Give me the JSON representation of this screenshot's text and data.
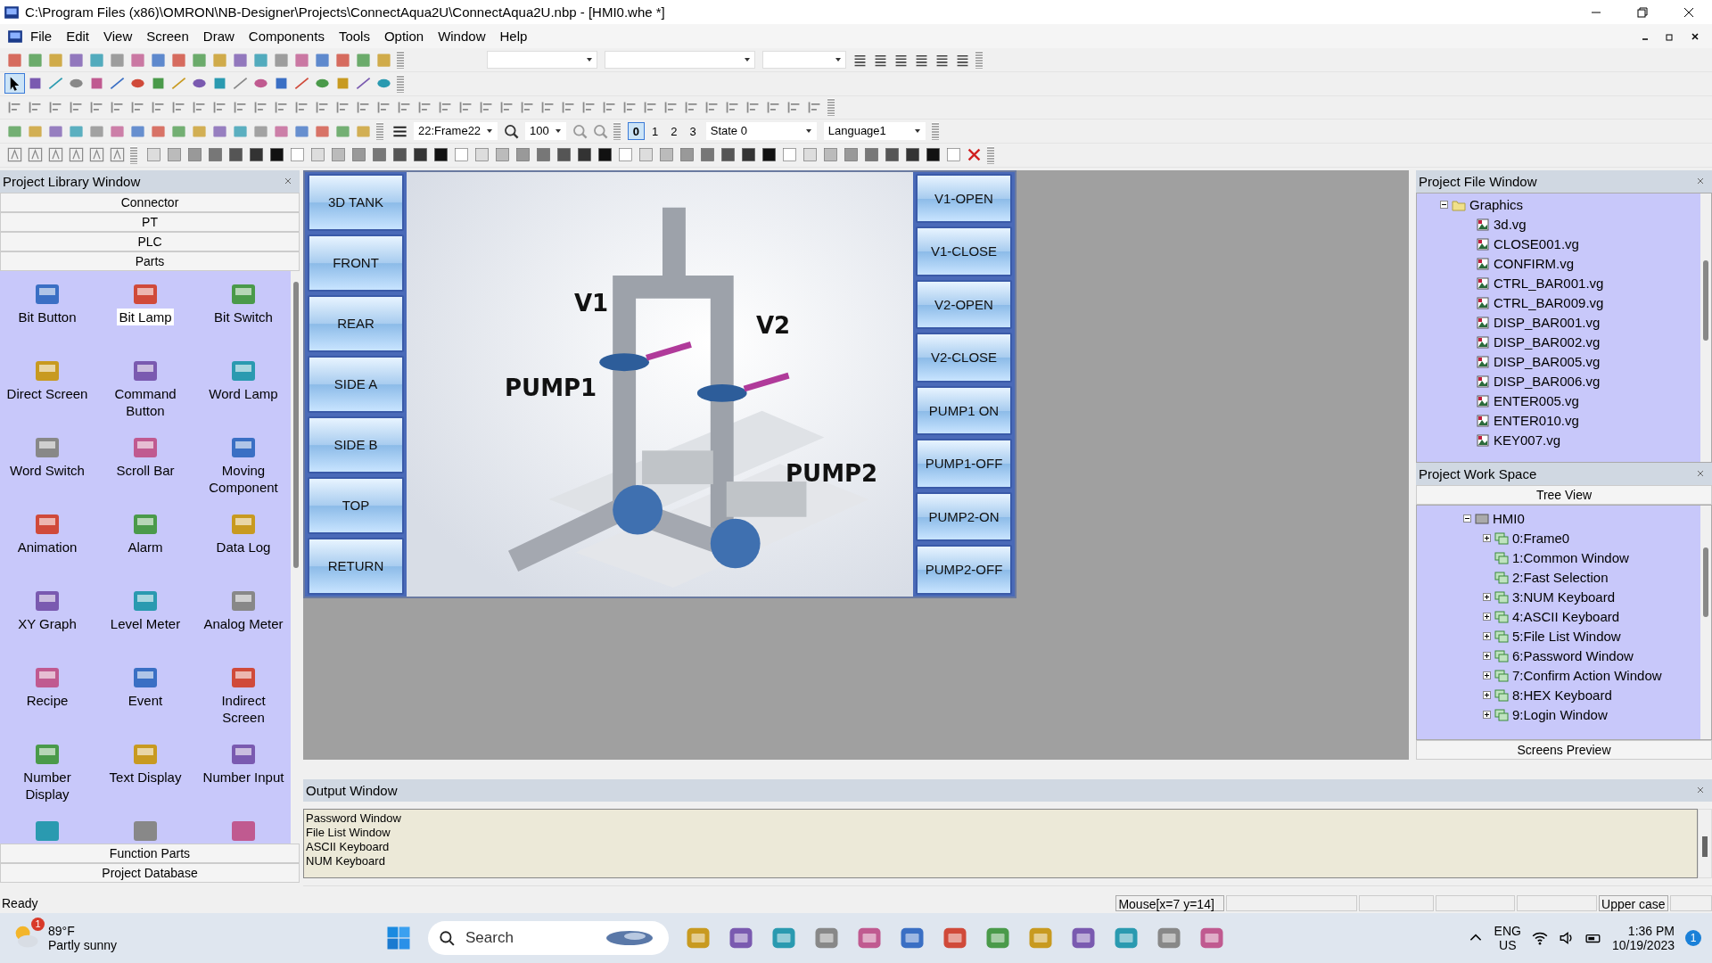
{
  "window": {
    "title": "C:\\Program Files (x86)\\OMRON\\NB-Designer\\Projects\\ConnectAqua2U\\ConnectAqua2U.nbp - [HMI0.whe *]"
  },
  "menu": [
    "File",
    "Edit",
    "View",
    "Screen",
    "Draw",
    "Components",
    "Tools",
    "Option",
    "Window",
    "Help"
  ],
  "toolbar": {
    "frame": "22:Frame22",
    "zoom": "100",
    "states": [
      {
        "label": "0",
        "selected": true
      },
      {
        "label": "1",
        "selected": false
      },
      {
        "label": "2",
        "selected": false
      },
      {
        "label": "3",
        "selected": false
      }
    ],
    "state": "State 0",
    "language": "Language1"
  },
  "library": {
    "title": "Project Library Window",
    "sections_top": [
      "Connector",
      "PT",
      "PLC",
      "Parts"
    ],
    "parts": [
      {
        "label": "Bit Button",
        "selected": false
      },
      {
        "label": "Bit Lamp",
        "selected": true
      },
      {
        "label": "Bit Switch",
        "selected": false
      },
      {
        "label": "Direct Screen",
        "selected": false
      },
      {
        "label": "Command Button",
        "selected": false
      },
      {
        "label": "Word Lamp",
        "selected": false
      },
      {
        "label": "Word Switch",
        "selected": false
      },
      {
        "label": "Scroll Bar",
        "selected": false
      },
      {
        "label": "Moving Component",
        "selected": false
      },
      {
        "label": "Animation",
        "selected": false
      },
      {
        "label": "Alarm",
        "selected": false
      },
      {
        "label": "Data Log",
        "selected": false
      },
      {
        "label": "XY Graph",
        "selected": false
      },
      {
        "label": "Level Meter",
        "selected": false
      },
      {
        "label": "Analog Meter",
        "selected": false
      },
      {
        "label": "Recipe",
        "selected": false
      },
      {
        "label": "Event",
        "selected": false
      },
      {
        "label": "Indirect Screen",
        "selected": false
      },
      {
        "label": "Number Display",
        "selected": false
      },
      {
        "label": "Text Display",
        "selected": false
      },
      {
        "label": "Number Input",
        "selected": false
      }
    ],
    "sections_bottom": [
      "Function Parts",
      "Project Database"
    ]
  },
  "hmi": {
    "left_buttons": [
      "3D TANK",
      "FRONT",
      "REAR",
      "SIDE A",
      "SIDE B",
      "TOP",
      "RETURN"
    ],
    "right_buttons": [
      "V1-OPEN",
      "V1-CLOSE",
      "V2-OPEN",
      "V2-CLOSE",
      "PUMP1 ON",
      "PUMP1-OFF",
      "PUMP2-ON",
      "PUMP2-OFF"
    ],
    "labels": [
      "V1",
      "V2",
      "PUMP1",
      "PUMP2"
    ]
  },
  "file_window": {
    "title": "Project File Window",
    "folder": {
      "label": "Graphics",
      "expanded": true,
      "children": [
        {
          "label": "3d.vg"
        },
        {
          "label": "CLOSE001.vg"
        },
        {
          "label": "CONFIRM.vg"
        },
        {
          "label": "CTRL_BAR001.vg"
        },
        {
          "label": "CTRL_BAR009.vg"
        },
        {
          "label": "DISP_BAR001.vg"
        },
        {
          "label": "DISP_BAR002.vg"
        },
        {
          "label": "DISP_BAR005.vg"
        },
        {
          "label": "DISP_BAR006.vg"
        },
        {
          "label": "ENTER005.vg"
        },
        {
          "label": "ENTER010.vg"
        },
        {
          "label": "KEY007.vg"
        }
      ]
    }
  },
  "workspace": {
    "title": "Project Work Space",
    "tab": "Tree View",
    "root": {
      "label": "HMI0",
      "expanded": true,
      "children": [
        {
          "label": "0:Frame0",
          "expandable": true
        },
        {
          "label": "1:Common Window",
          "expandable": false
        },
        {
          "label": "2:Fast Selection",
          "expandable": false
        },
        {
          "label": "3:NUM Keyboard",
          "expandable": true
        },
        {
          "label": "4:ASCII Keyboard",
          "expandable": true
        },
        {
          "label": "5:File List Window",
          "expandable": true
        },
        {
          "label": "6:Password Window",
          "expandable": true
        },
        {
          "label": "7:Confirm Action Window",
          "expandable": true
        },
        {
          "label": "8:HEX Keyboard",
          "expandable": true
        },
        {
          "label": "9:Login Window",
          "expandable": true
        }
      ]
    },
    "bottom_tab": "Screens Preview"
  },
  "output": {
    "title": "Output Window",
    "lines": [
      "Password Window",
      "File List Window",
      "ASCII Keyboard",
      "NUM Keyboard"
    ]
  },
  "status_bar": {
    "text": "Ready",
    "mouse": "Mouse[x=7  y=14]",
    "caps": "Upper case"
  },
  "taskbar": {
    "temperature": "89°F",
    "condition": "Partly sunny",
    "weather_badge": "1",
    "search": {
      "placeholder": "Search"
    },
    "language": "ENG",
    "region": "US",
    "time": "1:36 PM",
    "date": "10/19/2023",
    "notifications": "1"
  }
}
